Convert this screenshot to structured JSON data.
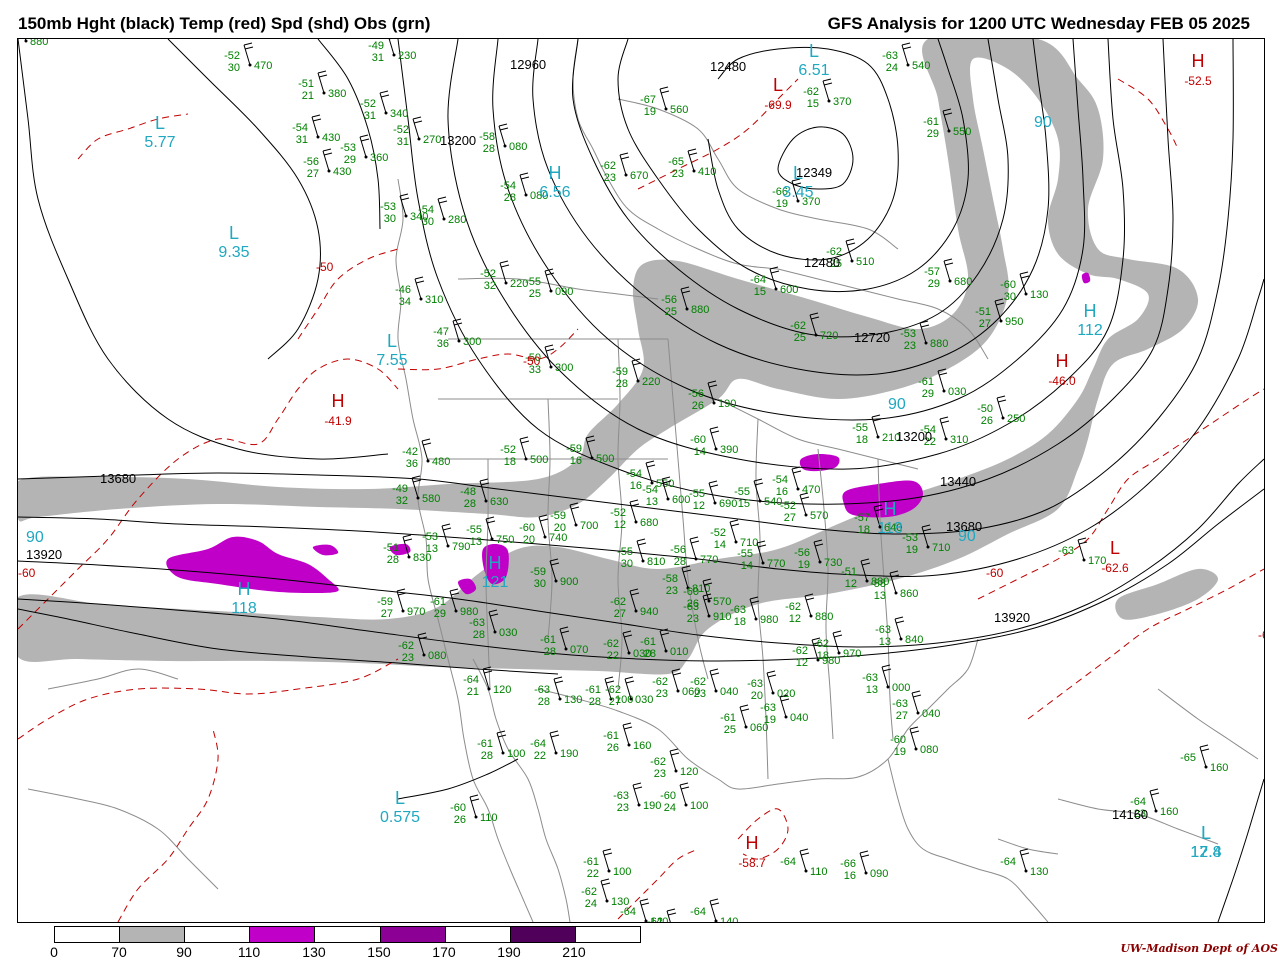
{
  "title_left": "150mb Hght (black) Temp (red) Spd (shd) Obs (grn)",
  "title_right": "GFS Analysis for 1200 UTC Wednesday  FEB 05 2025",
  "credit": "UW-Madison  Dept of AOS",
  "colors": {
    "height": "#000000",
    "temp": "#c00000",
    "obs": "#008000",
    "extrema": "#20a8c0",
    "speed_70_90": "#b4b4b4",
    "speed_110_130": "#c000c8",
    "speed_150_170": "#8c0096",
    "speed_190_210": "#50005a",
    "geography": "#8c8c8c"
  },
  "legend": {
    "ticks": [
      "0",
      "70",
      "90",
      "110",
      "130",
      "150",
      "170",
      "190",
      "210"
    ],
    "segment_colors": [
      "#ffffff",
      "#b4b4b4",
      "#ffffff",
      "#c000c8",
      "#ffffff",
      "#8c0096",
      "#ffffff",
      "#50005a",
      "#ffffff"
    ]
  },
  "height_contour_labels": [
    "12960",
    "13200",
    "12480",
    "12349",
    "12480",
    "12720",
    "13200",
    "13440",
    "13680",
    "13680",
    "13920",
    "13920",
    "14160"
  ],
  "temp_contour_labels": [
    "-50",
    "-50",
    "-60",
    "-60",
    "-60"
  ],
  "extrema": [
    {
      "type": "L",
      "value": "5.77",
      "kind": "speed"
    },
    {
      "type": "L",
      "value": "9.35",
      "kind": "speed"
    },
    {
      "type": "H",
      "value": "6.56",
      "kind": "speed"
    },
    {
      "type": "L",
      "value": "6.51",
      "kind": "speed"
    },
    {
      "type": "L",
      "value": "3.45",
      "kind": "speed"
    },
    {
      "type": "L",
      "value": "7.55",
      "kind": "speed"
    },
    {
      "type": "H",
      "value": "-41.9",
      "kind": "temp"
    },
    {
      "type": "L",
      "value": "-69.9",
      "kind": "temp"
    },
    {
      "type": "H",
      "value": "-52.5",
      "kind": "temp"
    },
    {
      "type": "H",
      "value": "-46.0",
      "kind": "temp"
    },
    {
      "type": "H",
      "value": "112",
      "kind": "speed"
    },
    {
      "type": "H",
      "value": "118",
      "kind": "speed"
    },
    {
      "type": "H",
      "value": "121",
      "kind": "speed"
    },
    {
      "type": "H",
      "value": "118",
      "kind": "speed"
    },
    {
      "type": "L",
      "value": "0.575",
      "kind": "speed"
    },
    {
      "type": "L",
      "value": "-62.6",
      "kind": "temp"
    },
    {
      "type": "H",
      "value": "-58.7",
      "kind": "temp"
    },
    {
      "type": "L",
      "value": "12.4",
      "kind": "speed"
    },
    {
      "type": "L",
      "value": "17.8",
      "kind": "speed"
    }
  ],
  "speed_labels": [
    "90",
    "90",
    "90",
    "90"
  ],
  "observations": [
    {
      "t": "-52",
      "h": "470",
      "d": "30"
    },
    {
      "t": "-49",
      "h": "230",
      "d": "31"
    },
    {
      "t": "-51",
      "h": "380",
      "d": "21"
    },
    {
      "t": "-52",
      "h": "340",
      "d": "31"
    },
    {
      "t": "-54",
      "h": "430",
      "d": "31"
    },
    {
      "t": "-52",
      "h": "270",
      "d": "31"
    },
    {
      "t": "-53",
      "h": "360",
      "d": "29"
    },
    {
      "t": "-56",
      "h": "430",
      "d": "27"
    },
    {
      "t": "-58",
      "h": "080",
      "d": "28"
    },
    {
      "t": "-54",
      "h": "080",
      "d": "28"
    },
    {
      "t": "-53",
      "h": "340",
      "d": "30"
    },
    {
      "t": "-54",
      "h": "280",
      "d": "30"
    },
    {
      "t": "-52",
      "h": "220",
      "d": "32"
    },
    {
      "t": "-55",
      "h": "090",
      "d": "25"
    },
    {
      "t": "-46",
      "h": "310",
      "d": "34"
    },
    {
      "t": "-47",
      "h": "300",
      "d": "36"
    },
    {
      "t": "-50",
      "h": "300",
      "d": "33"
    },
    {
      "t": "-63",
      "h": "540",
      "d": "24"
    },
    {
      "t": "-62",
      "h": "370",
      "d": "15"
    },
    {
      "t": "-61",
      "h": "550",
      "d": "29"
    },
    {
      "t": "-67",
      "h": "560",
      "d": "19"
    },
    {
      "t": "-62",
      "h": "670",
      "d": "23"
    },
    {
      "t": "-65",
      "h": "410",
      "d": "23"
    },
    {
      "t": "-66",
      "h": "370",
      "d": "19"
    },
    {
      "t": "-62",
      "h": "510",
      "d": "25"
    },
    {
      "t": "-57",
      "h": "680",
      "d": "29"
    },
    {
      "t": "-64",
      "h": "600",
      "d": "15"
    },
    {
      "t": "-56",
      "h": "880",
      "d": "25"
    },
    {
      "t": "-62",
      "h": "720",
      "d": "25"
    },
    {
      "t": "-60",
      "h": "130",
      "d": "30"
    },
    {
      "t": "-51",
      "h": "950",
      "d": "27"
    },
    {
      "t": "-53",
      "h": "880",
      "d": "23"
    },
    {
      "t": "-61",
      "h": "030",
      "d": "29"
    },
    {
      "t": "-50",
      "h": "250",
      "d": "26"
    },
    {
      "t": "-55",
      "h": "210",
      "d": "18"
    },
    {
      "t": "-54",
      "h": "310",
      "d": "22"
    },
    {
      "t": "-59",
      "h": "220",
      "d": "28"
    },
    {
      "t": "-56",
      "h": "190",
      "d": "26"
    },
    {
      "t": "-60",
      "h": "390",
      "d": "14"
    },
    {
      "t": "-42",
      "h": "480",
      "d": "36"
    },
    {
      "t": "-52",
      "h": "500",
      "d": "18"
    },
    {
      "t": "-59",
      "h": "500",
      "d": "16"
    },
    {
      "t": "-54",
      "h": "550",
      "d": "16"
    },
    {
      "t": "-49",
      "h": "580",
      "d": "32"
    },
    {
      "t": "-48",
      "h": "630",
      "d": "28"
    },
    {
      "t": "-54",
      "h": "600",
      "d": "13"
    },
    {
      "t": "-55",
      "h": "690",
      "d": "12"
    },
    {
      "t": "-55",
      "h": "540",
      "d": "15"
    },
    {
      "t": "-54",
      "h": "470",
      "d": "16"
    },
    {
      "t": "-52",
      "h": "680",
      "d": "12"
    },
    {
      "t": "-52",
      "h": "570",
      "d": "27"
    },
    {
      "t": "-57",
      "h": "640",
      "d": "18"
    },
    {
      "t": "-53",
      "h": "790",
      "d": "13"
    },
    {
      "t": "-55",
      "h": "750",
      "d": "13"
    },
    {
      "t": "-60",
      "h": "740",
      "d": "20"
    },
    {
      "t": "-59",
      "h": "700",
      "d": "20"
    },
    {
      "t": "-52",
      "h": "710",
      "d": "14"
    },
    {
      "t": "-53",
      "h": "710",
      "d": "19"
    },
    {
      "t": "-51",
      "h": "830",
      "d": "28"
    },
    {
      "t": "-55",
      "h": "810",
      "d": "30"
    },
    {
      "t": "-56",
      "h": "770",
      "d": "28"
    },
    {
      "t": "-55",
      "h": "770",
      "d": "14"
    },
    {
      "t": "-56",
      "h": "730",
      "d": "19"
    },
    {
      "t": "-58",
      "h": "810",
      "d": "23"
    },
    {
      "t": "-59",
      "h": "900",
      "d": "30"
    },
    {
      "t": "-51",
      "h": "880",
      "d": "12"
    },
    {
      "t": "-58",
      "h": "860",
      "d": "13"
    },
    {
      "t": "-59",
      "h": "970",
      "d": "27"
    },
    {
      "t": "-61",
      "h": "980",
      "d": "29"
    },
    {
      "t": "-63",
      "h": "030",
      "d": "28"
    },
    {
      "t": "-61",
      "h": "070",
      "d": "28"
    },
    {
      "t": "-62",
      "h": "940",
      "d": "27"
    },
    {
      "t": "-60",
      "h": "570",
      "d": "26"
    },
    {
      "t": "-63",
      "h": "910",
      "d": "23"
    },
    {
      "t": "-63",
      "h": "980",
      "d": "18"
    },
    {
      "t": "-62",
      "h": "880",
      "d": "12"
    },
    {
      "t": "-63",
      "h": "840",
      "d": "13"
    },
    {
      "t": "-62",
      "h": "080",
      "d": "23"
    },
    {
      "t": "-62",
      "h": "030",
      "d": "22"
    },
    {
      "t": "-61",
      "h": "010",
      "d": "28"
    },
    {
      "t": "-62",
      "h": "980",
      "d": "12"
    },
    {
      "t": "-62",
      "h": "970",
      "d": "18"
    },
    {
      "t": "-63",
      "h": "000",
      "d": "13"
    },
    {
      "t": "-64",
      "h": "120",
      "d": "21"
    },
    {
      "t": "-63",
      "h": "130",
      "d": "28"
    },
    {
      "t": "-61",
      "h": "100",
      "d": "28"
    },
    {
      "t": "-62",
      "h": "060",
      "d": "23"
    },
    {
      "t": "-62",
      "h": "040",
      "d": "23"
    },
    {
      "t": "-63",
      "h": "020",
      "d": "20"
    },
    {
      "t": "-63",
      "h": "040",
      "d": "19"
    },
    {
      "t": "-61",
      "h": "060",
      "d": "25"
    },
    {
      "t": "-62",
      "h": "030",
      "d": "27"
    },
    {
      "t": "-63",
      "h": "040",
      "d": "27"
    },
    {
      "t": "-60",
      "h": "080",
      "d": "19"
    },
    {
      "t": "-61",
      "h": "100",
      "d": "28"
    },
    {
      "t": "-64",
      "h": "190",
      "d": "22"
    },
    {
      "t": "-61",
      "h": "160",
      "d": "26"
    },
    {
      "t": "-62",
      "h": "120",
      "d": "23"
    },
    {
      "t": "-60",
      "h": "110",
      "d": "26"
    },
    {
      "t": "-63",
      "h": "190",
      "d": "23"
    },
    {
      "t": "-60",
      "h": "100",
      "d": "24"
    },
    {
      "t": "-61",
      "h": "100",
      "d": "22"
    },
    {
      "t": "-62",
      "h": "130",
      "d": "24"
    },
    {
      "t": "-62",
      "h": "120",
      "d": "23"
    },
    {
      "t": "-64",
      "h": "140",
      "d": ""
    },
    {
      "t": "-64",
      "h": "140",
      "d": ""
    },
    {
      "t": "-64",
      "h": "110",
      "d": ""
    },
    {
      "t": "-66",
      "h": "090",
      "d": "16"
    },
    {
      "t": "-64",
      "h": "130",
      "d": ""
    },
    {
      "t": "-64",
      "h": "160",
      "d": "23"
    },
    {
      "t": "-65",
      "h": "160",
      "d": ""
    },
    {
      "t": "-63",
      "h": "170",
      "d": ""
    },
    {
      "t": "-62",
      "h": "880",
      "d": "12"
    }
  ]
}
